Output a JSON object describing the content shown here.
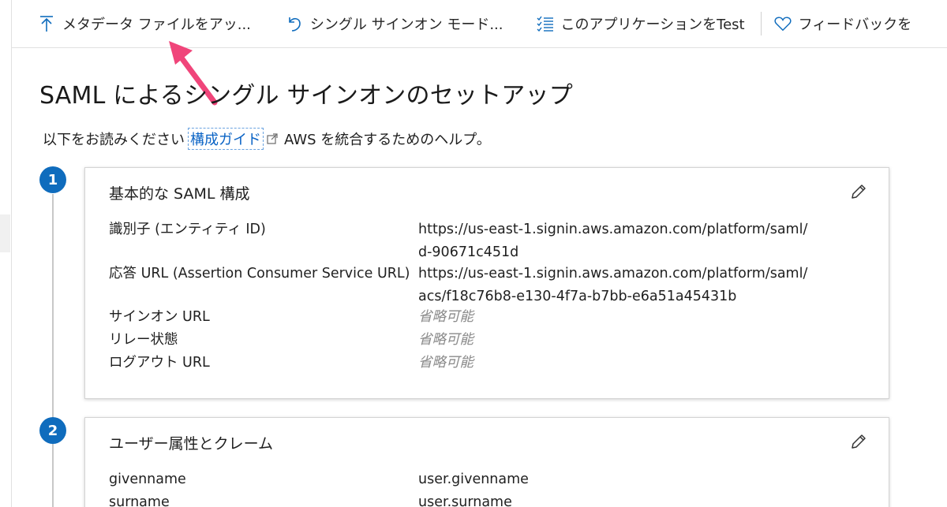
{
  "toolbar": {
    "upload_metadata": "メタデータ ファイルをアッ...",
    "sso_mode": "シングル サインオン モード...",
    "test_app": "このアプリケーションをTest",
    "feedback": "フィードバックを"
  },
  "page": {
    "title": "SAML によるシングル サインオンのセットアップ",
    "intro_before": "以下をお読みください",
    "intro_link": "構成ガイド",
    "intro_after": "AWS を統合するためのヘルプ。"
  },
  "steps": [
    {
      "number": "1",
      "title": "基本的な SAML 構成",
      "rows": [
        {
          "label": "識別子 (エンティティ ID)",
          "value_line1": "https://us-east-1.signin.aws.amazon.com/platform/saml/",
          "value_line2": "d-90671c451d"
        },
        {
          "label": "応答 URL (Assertion Consumer Service URL)",
          "value_line1": "https://us-east-1.signin.aws.amazon.com/platform/saml/",
          "value_line2": "acs/f18c76b8-e130-4f7a-b7bb-e6a51a45431b"
        },
        {
          "label": "サインオン URL",
          "value": "省略可能"
        },
        {
          "label": "リレー状態",
          "value": "省略可能"
        },
        {
          "label": "ログアウト URL",
          "value": "省略可能"
        }
      ]
    },
    {
      "number": "2",
      "title": "ユーザー属性とクレーム",
      "rows": [
        {
          "label": "givenname",
          "value": "user.givenname"
        },
        {
          "label": "surname",
          "value": "user.surname"
        }
      ]
    }
  ],
  "colors": {
    "accent": "#0f6cbd",
    "link": "#0a63c5",
    "annotation_arrow": "#f0457a",
    "placeholder": "#8a8a8a"
  },
  "icons": {
    "upload": "upload-arrow-icon",
    "undo": "undo-icon",
    "checklist": "checklist-icon",
    "heart": "heart-icon",
    "external": "external-link-icon",
    "edit": "pencil-icon"
  }
}
